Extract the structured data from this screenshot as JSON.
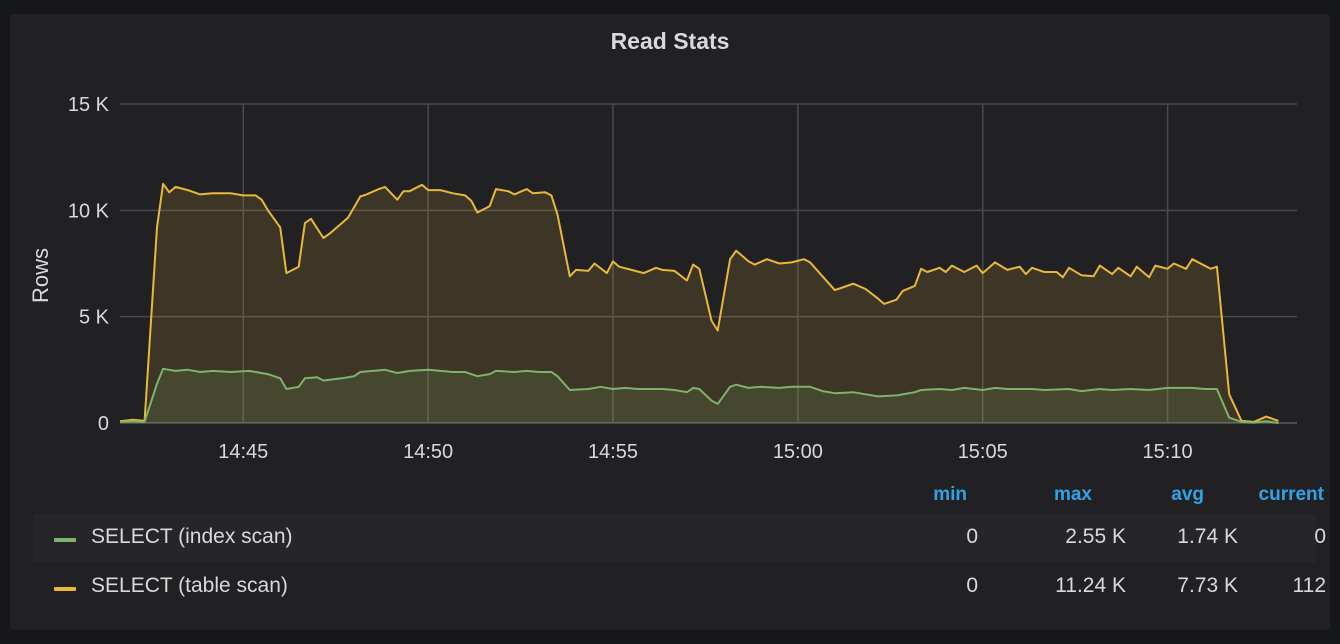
{
  "panel": {
    "title": "Read Stats"
  },
  "legend": {
    "headers": {
      "min": "min",
      "max": "max",
      "avg": "avg",
      "current": "current"
    },
    "rows": [
      {
        "name": "SELECT (index scan)",
        "color": "#7eb26d",
        "min": "0",
        "max": "2.55 K",
        "avg": "1.74 K",
        "current": "0"
      },
      {
        "name": "SELECT (table scan)",
        "color": "#eab839",
        "min": "0",
        "max": "11.24 K",
        "avg": "7.73 K",
        "current": "112"
      }
    ]
  },
  "chart_data": {
    "type": "area",
    "title": "Read Stats",
    "ylabel": "Rows",
    "xlabel": "",
    "x_ticks": [
      "14:45",
      "14:50",
      "14:55",
      "15:00",
      "15:05",
      "15:10"
    ],
    "y_ticks": [
      "0",
      "5 K",
      "10 K",
      "15 K"
    ],
    "ylim": [
      0,
      15000
    ],
    "xlim": [
      "14:41:40",
      "15:13:30"
    ],
    "grid": true,
    "legend_position": "bottom",
    "series": [
      {
        "name": "SELECT (table scan)",
        "color": "#eab839",
        "points": [
          [
            "14:41:40",
            80
          ],
          [
            "14:42:00",
            150
          ],
          [
            "14:42:20",
            100
          ],
          [
            "14:42:40",
            9200
          ],
          [
            "14:42:50",
            11250
          ],
          [
            "14:43:00",
            10850
          ],
          [
            "14:43:10",
            11100
          ],
          [
            "14:43:30",
            10950
          ],
          [
            "14:43:50",
            10750
          ],
          [
            "14:44:10",
            10800
          ],
          [
            "14:44:40",
            10800
          ],
          [
            "14:45:00",
            10700
          ],
          [
            "14:45:20",
            10700
          ],
          [
            "14:45:30",
            10500
          ],
          [
            "14:45:40",
            10000
          ],
          [
            "14:46:00",
            9200
          ],
          [
            "14:46:10",
            7050
          ],
          [
            "14:46:30",
            7350
          ],
          [
            "14:46:40",
            9400
          ],
          [
            "14:46:50",
            9600
          ],
          [
            "14:47:10",
            8700
          ],
          [
            "14:47:20",
            8900
          ],
          [
            "14:47:40",
            9400
          ],
          [
            "14:47:50",
            9650
          ],
          [
            "14:48:10",
            10650
          ],
          [
            "14:48:20",
            10750
          ],
          [
            "14:48:40",
            11000
          ],
          [
            "14:48:50",
            11100
          ],
          [
            "14:49:10",
            10500
          ],
          [
            "14:49:20",
            10900
          ],
          [
            "14:49:30",
            10900
          ],
          [
            "14:49:50",
            11200
          ],
          [
            "14:50:00",
            10950
          ],
          [
            "14:50:20",
            10950
          ],
          [
            "14:50:40",
            10800
          ],
          [
            "14:51:00",
            10700
          ],
          [
            "14:51:10",
            10450
          ],
          [
            "14:51:20",
            9900
          ],
          [
            "14:51:40",
            10200
          ],
          [
            "14:51:50",
            11000
          ],
          [
            "14:52:10",
            10900
          ],
          [
            "14:52:20",
            10750
          ],
          [
            "14:52:40",
            11000
          ],
          [
            "14:52:50",
            10800
          ],
          [
            "14:53:10",
            10850
          ],
          [
            "14:53:20",
            10700
          ],
          [
            "14:53:30",
            9800
          ],
          [
            "14:53:50",
            6900
          ],
          [
            "14:54:00",
            7200
          ],
          [
            "14:54:20",
            7150
          ],
          [
            "14:54:30",
            7500
          ],
          [
            "14:54:50",
            7050
          ],
          [
            "14:55:00",
            7600
          ],
          [
            "14:55:10",
            7350
          ],
          [
            "14:55:30",
            7200
          ],
          [
            "14:55:50",
            7050
          ],
          [
            "14:56:10",
            7300
          ],
          [
            "14:56:20",
            7200
          ],
          [
            "14:56:40",
            7150
          ],
          [
            "14:57:00",
            6700
          ],
          [
            "14:57:10",
            7450
          ],
          [
            "14:57:20",
            7250
          ],
          [
            "14:57:40",
            4800
          ],
          [
            "14:57:50",
            4350
          ],
          [
            "14:58:10",
            7700
          ],
          [
            "14:58:20",
            8100
          ],
          [
            "14:58:40",
            7600
          ],
          [
            "14:58:50",
            7450
          ],
          [
            "14:59:10",
            7700
          ],
          [
            "14:59:30",
            7500
          ],
          [
            "14:59:50",
            7550
          ],
          [
            "15:00:10",
            7700
          ],
          [
            "15:00:20",
            7550
          ],
          [
            "15:00:40",
            6900
          ],
          [
            "15:01:00",
            6250
          ],
          [
            "15:01:10",
            6350
          ],
          [
            "15:01:30",
            6550
          ],
          [
            "15:01:50",
            6300
          ],
          [
            "15:02:10",
            5850
          ],
          [
            "15:02:20",
            5600
          ],
          [
            "15:02:40",
            5800
          ],
          [
            "15:02:50",
            6200
          ],
          [
            "15:03:10",
            6450
          ],
          [
            "15:03:20",
            7250
          ],
          [
            "15:03:30",
            7100
          ],
          [
            "15:03:50",
            7300
          ],
          [
            "15:04:00",
            7100
          ],
          [
            "15:04:10",
            7400
          ],
          [
            "15:04:30",
            7100
          ],
          [
            "15:04:50",
            7400
          ],
          [
            "15:05:00",
            7050
          ],
          [
            "15:05:20",
            7550
          ],
          [
            "15:05:40",
            7200
          ],
          [
            "15:06:00",
            7350
          ],
          [
            "15:06:10",
            7000
          ],
          [
            "15:06:20",
            7300
          ],
          [
            "15:06:40",
            7100
          ],
          [
            "15:07:00",
            7100
          ],
          [
            "15:07:10",
            6850
          ],
          [
            "15:07:20",
            7300
          ],
          [
            "15:07:40",
            6950
          ],
          [
            "15:08:00",
            6900
          ],
          [
            "15:08:10",
            7400
          ],
          [
            "15:08:30",
            7000
          ],
          [
            "15:08:40",
            7300
          ],
          [
            "15:09:00",
            6900
          ],
          [
            "15:09:10",
            7350
          ],
          [
            "15:09:30",
            6850
          ],
          [
            "15:09:40",
            7400
          ],
          [
            "15:10:00",
            7250
          ],
          [
            "15:10:10",
            7500
          ],
          [
            "15:10:30",
            7250
          ],
          [
            "15:10:40",
            7700
          ],
          [
            "15:11:00",
            7400
          ],
          [
            "15:11:10",
            7250
          ],
          [
            "15:11:20",
            7350
          ],
          [
            "15:11:40",
            1350
          ],
          [
            "15:12:00",
            100
          ],
          [
            "15:12:20",
            50
          ],
          [
            "15:12:40",
            300
          ],
          [
            "15:13:00",
            100
          ]
        ]
      },
      {
        "name": "SELECT (index scan)",
        "color": "#7eb26d",
        "points": [
          [
            "14:41:40",
            50
          ],
          [
            "14:42:00",
            80
          ],
          [
            "14:42:20",
            60
          ],
          [
            "14:42:40",
            1850
          ],
          [
            "14:42:50",
            2550
          ],
          [
            "14:43:10",
            2450
          ],
          [
            "14:43:30",
            2500
          ],
          [
            "14:43:50",
            2400
          ],
          [
            "14:44:10",
            2450
          ],
          [
            "14:44:40",
            2400
          ],
          [
            "14:45:10",
            2450
          ],
          [
            "14:45:40",
            2300
          ],
          [
            "14:46:00",
            2100
          ],
          [
            "14:46:10",
            1600
          ],
          [
            "14:46:30",
            1700
          ],
          [
            "14:46:40",
            2100
          ],
          [
            "14:47:00",
            2150
          ],
          [
            "14:47:10",
            2000
          ],
          [
            "14:47:40",
            2100
          ],
          [
            "14:48:00",
            2200
          ],
          [
            "14:48:10",
            2400
          ],
          [
            "14:48:30",
            2450
          ],
          [
            "14:48:50",
            2500
          ],
          [
            "14:49:10",
            2350
          ],
          [
            "14:49:30",
            2450
          ],
          [
            "14:50:00",
            2500
          ],
          [
            "14:50:20",
            2450
          ],
          [
            "14:50:40",
            2400
          ],
          [
            "14:51:00",
            2400
          ],
          [
            "14:51:20",
            2200
          ],
          [
            "14:51:40",
            2300
          ],
          [
            "14:51:50",
            2450
          ],
          [
            "14:52:20",
            2400
          ],
          [
            "14:52:40",
            2450
          ],
          [
            "14:53:00",
            2400
          ],
          [
            "14:53:20",
            2400
          ],
          [
            "14:53:30",
            2200
          ],
          [
            "14:53:50",
            1550
          ],
          [
            "14:54:20",
            1600
          ],
          [
            "14:54:40",
            1700
          ],
          [
            "14:55:00",
            1600
          ],
          [
            "14:55:20",
            1650
          ],
          [
            "14:55:40",
            1600
          ],
          [
            "14:56:20",
            1600
          ],
          [
            "14:56:40",
            1550
          ],
          [
            "14:57:00",
            1450
          ],
          [
            "14:57:10",
            1650
          ],
          [
            "14:57:20",
            1600
          ],
          [
            "14:57:40",
            1050
          ],
          [
            "14:57:50",
            900
          ],
          [
            "14:58:10",
            1700
          ],
          [
            "14:58:20",
            1800
          ],
          [
            "14:58:40",
            1650
          ],
          [
            "14:59:00",
            1700
          ],
          [
            "14:59:30",
            1650
          ],
          [
            "14:59:50",
            1700
          ],
          [
            "15:00:20",
            1700
          ],
          [
            "15:00:40",
            1500
          ],
          [
            "15:01:00",
            1400
          ],
          [
            "15:01:30",
            1450
          ],
          [
            "15:01:50",
            1350
          ],
          [
            "15:02:10",
            1250
          ],
          [
            "15:02:40",
            1300
          ],
          [
            "15:03:10",
            1450
          ],
          [
            "15:03:20",
            1550
          ],
          [
            "15:03:50",
            1600
          ],
          [
            "15:04:10",
            1550
          ],
          [
            "15:04:30",
            1650
          ],
          [
            "15:05:00",
            1550
          ],
          [
            "15:05:20",
            1650
          ],
          [
            "15:05:40",
            1600
          ],
          [
            "15:06:20",
            1600
          ],
          [
            "15:06:40",
            1550
          ],
          [
            "15:07:20",
            1600
          ],
          [
            "15:07:40",
            1500
          ],
          [
            "15:08:10",
            1600
          ],
          [
            "15:08:30",
            1550
          ],
          [
            "15:09:00",
            1600
          ],
          [
            "15:09:30",
            1550
          ],
          [
            "15:10:00",
            1650
          ],
          [
            "15:10:40",
            1650
          ],
          [
            "15:11:00",
            1600
          ],
          [
            "15:11:20",
            1600
          ],
          [
            "15:11:40",
            250
          ],
          [
            "15:12:00",
            50
          ],
          [
            "15:12:20",
            20
          ],
          [
            "15:12:40",
            80
          ],
          [
            "15:13:00",
            0
          ]
        ]
      }
    ]
  }
}
